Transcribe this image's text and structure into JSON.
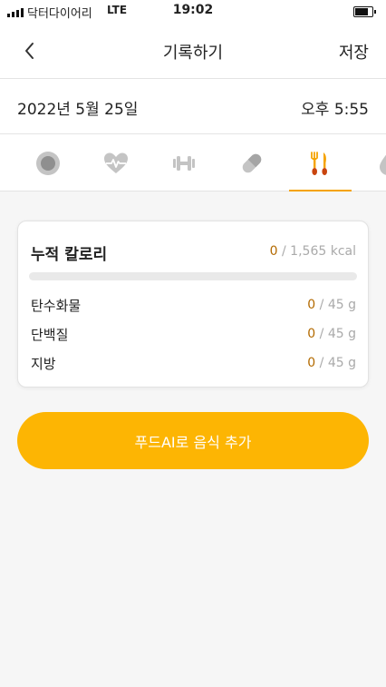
{
  "status_bar": {
    "carrier": "닥터다이어리",
    "network": "LTE",
    "time": "19:02"
  },
  "header": {
    "title": "기록하기",
    "save_label": "저장"
  },
  "record": {
    "date": "2022년 5월 25일",
    "time": "오후 5:55"
  },
  "tabs": [
    {
      "icon": "circle-icon",
      "active": false
    },
    {
      "icon": "heart-pulse-icon",
      "active": false
    },
    {
      "icon": "dumbbell-icon",
      "active": false
    },
    {
      "icon": "pill-icon",
      "active": false
    },
    {
      "icon": "fork-knife-icon",
      "active": true
    },
    {
      "icon": "droplet-icon",
      "active": false
    }
  ],
  "colors": {
    "accent": "#fdb503",
    "value_text": "#b36a00",
    "muted": "#aaaaaa"
  },
  "calories": {
    "title": "누적 칼로리",
    "current": "0",
    "total": "/ 1,565 kcal",
    "progress": 0
  },
  "nutrients": [
    {
      "label": "탄수화물",
      "current": "0",
      "total": "/ 45 g"
    },
    {
      "label": "단백질",
      "current": "0",
      "total": "/ 45 g"
    },
    {
      "label": "지방",
      "current": "0",
      "total": "/ 45 g"
    }
  ],
  "add_button_label": "푸드AI로 음식 추가"
}
